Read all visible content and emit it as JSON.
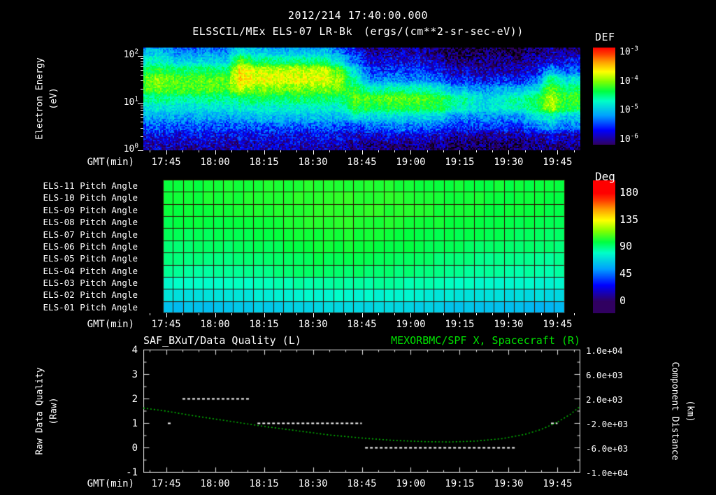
{
  "header": {
    "datetime": "2012/214 17:40:00.000"
  },
  "time_axis": {
    "title": "GMT(min)",
    "ticks": [
      "17:45",
      "18:00",
      "18:15",
      "18:30",
      "18:45",
      "19:00",
      "19:15",
      "19:30",
      "19:45"
    ],
    "start_min": 1058,
    "end_min": 1192
  },
  "colors": {
    "background": "#000000",
    "text": "#ffffff",
    "title_right_green": "#00e300",
    "distance_curve_green": "#00b800",
    "pitch_grid": "#2e0e00",
    "axis_box": "#e8e8e8"
  },
  "colormap": {
    "positions": [
      0,
      0.15,
      0.3,
      0.45,
      0.55,
      0.65,
      0.75,
      0.85,
      0.93,
      1
    ],
    "colors": [
      "#300060",
      "#0000ff",
      "#00a0ff",
      "#00ffc8",
      "#00ff40",
      "#80ff00",
      "#ffff00",
      "#ffa000",
      "#ff4000",
      "#ff0000"
    ]
  },
  "chart_data": [
    {
      "type": "heatmap",
      "title": "ELSSCIL/MEx ELS-07 LR-Bk",
      "units_display": "(ergs/(cm**2-sr-sec-eV))",
      "xlabel": "GMT(min)",
      "ylabel_line1": "Electron Energy",
      "ylabel_line2": "(eV)",
      "log_label_base": "10",
      "y_scale": "log",
      "y_tick_exponents": [
        2,
        1,
        0
      ],
      "log_energy_min": 0,
      "log_energy_max": 2.18,
      "colorbar": {
        "title": "DEF",
        "tick_exponents": [
          -3,
          -4,
          -5,
          -6
        ],
        "log_min": -6.15,
        "log_max": -2.8
      },
      "grid": {
        "t0_min": 1058,
        "dt_min": 5,
        "log_e_row0": 0.1,
        "dlog_e": 0.2,
        "rows_bottom_to_top": [
          [
            -5.9,
            -5.9,
            -5.9,
            -5.9,
            -5.9,
            -5.9,
            -5.9,
            -5.9,
            -5.9,
            -5.9,
            -5.9,
            -5.9,
            -5.9,
            -6.0,
            -6.1,
            -6.1,
            -6.1,
            -6.1,
            -6.1,
            -6.2,
            -6.2,
            -6.2,
            -6.2,
            -6.2,
            -6.1,
            -6.1,
            -6.1
          ],
          [
            -5.7,
            -5.7,
            -5.7,
            -5.7,
            -5.7,
            -5.7,
            -5.7,
            -5.7,
            -5.7,
            -5.7,
            -5.7,
            -5.7,
            -5.7,
            -5.8,
            -5.8,
            -5.8,
            -5.8,
            -5.8,
            -5.8,
            -6.0,
            -6.0,
            -6.0,
            -6.0,
            -6.0,
            -5.9,
            -5.8,
            -5.9
          ],
          [
            -5.4,
            -5.4,
            -5.4,
            -5.4,
            -5.4,
            -5.4,
            -5.4,
            -5.4,
            -5.4,
            -5.4,
            -5.4,
            -5.4,
            -5.4,
            -5.5,
            -5.3,
            -5.3,
            -5.3,
            -5.3,
            -5.3,
            -5.5,
            -5.5,
            -5.5,
            -5.5,
            -5.5,
            -5.3,
            -5.1,
            -5.3
          ],
          [
            -5.1,
            -5.1,
            -5.1,
            -5.1,
            -5.1,
            -5.1,
            -5.0,
            -5.0,
            -5.0,
            -5.0,
            -5.0,
            -5.0,
            -5.0,
            -4.8,
            -4.9,
            -4.9,
            -4.9,
            -4.9,
            -4.9,
            -5.2,
            -5.2,
            -5.2,
            -5.2,
            -5.2,
            -4.9,
            -4.7,
            -5.0
          ],
          [
            -4.8,
            -4.8,
            -4.8,
            -4.8,
            -4.8,
            -4.8,
            -4.7,
            -4.7,
            -4.7,
            -4.7,
            -4.7,
            -4.7,
            -4.7,
            -4.3,
            -4.3,
            -4.3,
            -4.3,
            -4.3,
            -4.3,
            -4.6,
            -4.7,
            -4.9,
            -4.7,
            -4.6,
            -4.4,
            -3.9,
            -4.3
          ],
          [
            -4.5,
            -4.5,
            -4.5,
            -4.5,
            -4.5,
            -4.5,
            -4.4,
            -4.4,
            -4.4,
            -4.4,
            -4.4,
            -4.4,
            -4.4,
            -4.1,
            -4.1,
            -4.1,
            -4.1,
            -4.1,
            -4.2,
            -4.5,
            -4.6,
            -4.9,
            -4.7,
            -4.5,
            -4.4,
            -3.9,
            -4.2
          ],
          [
            -4.1,
            -4.1,
            -4.1,
            -4.1,
            -4.1,
            -4.1,
            -3.8,
            -4.0,
            -4.0,
            -4.0,
            -4.0,
            -4.0,
            -4.0,
            -4.3,
            -4.6,
            -4.6,
            -4.6,
            -4.6,
            -4.7,
            -5.0,
            -5.1,
            -5.2,
            -5.1,
            -5.0,
            -4.9,
            -4.1,
            -4.4
          ],
          [
            -4.1,
            -4.0,
            -4.1,
            -4.1,
            -4.1,
            -4.1,
            -3.5,
            -3.7,
            -3.7,
            -3.7,
            -3.7,
            -3.7,
            -3.9,
            -4.6,
            -5.2,
            -5.2,
            -5.2,
            -5.2,
            -5.3,
            -5.6,
            -5.6,
            -5.7,
            -5.6,
            -5.6,
            -5.4,
            -4.5,
            -4.8
          ],
          [
            -4.4,
            -4.3,
            -4.4,
            -4.4,
            -4.4,
            -4.4,
            -3.6,
            -3.8,
            -3.8,
            -3.8,
            -3.8,
            -3.8,
            -4.1,
            -4.9,
            -5.5,
            -5.5,
            -5.5,
            -5.5,
            -5.6,
            -5.9,
            -5.9,
            -6.0,
            -5.9,
            -5.9,
            -5.7,
            -5.2,
            -5.4
          ],
          [
            -4.7,
            -4.7,
            -4.9,
            -4.9,
            -4.9,
            -4.9,
            -4.1,
            -4.5,
            -4.5,
            -4.5,
            -4.5,
            -4.5,
            -4.8,
            -5.3,
            -5.8,
            -5.8,
            -5.8,
            -5.8,
            -5.9,
            -6.1,
            -6.1,
            -6.1,
            -6.1,
            -6.1,
            -6.0,
            -5.8,
            -5.7
          ],
          [
            -5.0,
            -5.0,
            -5.2,
            -5.2,
            -5.2,
            -5.2,
            -4.7,
            -5.0,
            -5.0,
            -5.0,
            -5.0,
            -5.0,
            -5.2,
            -5.6,
            -6.0,
            -6.0,
            -6.0,
            -6.0,
            -6.1,
            -6.3,
            -6.3,
            -6.3,
            -6.3,
            -6.3,
            -6.2,
            -6.0,
            -6.1
          ],
          [
            -5.6,
            -5.6,
            -5.6,
            -5.6,
            -5.6,
            -5.6,
            -5.4,
            -5.4,
            -5.4,
            -5.4,
            -5.4,
            -5.4,
            -5.6,
            -5.9,
            -6.2,
            -6.2,
            -6.2,
            -6.2,
            -6.2,
            -6.4,
            -6.4,
            -6.4,
            -6.4,
            -6.4,
            -6.3,
            -6.2,
            -6.3
          ]
        ]
      }
    },
    {
      "type": "heatmap",
      "xlabel": "GMT(min)",
      "row_labels_top_to_bottom": [
        "ELS-11 Pitch Angle",
        "ELS-10 Pitch Angle",
        "ELS-09 Pitch Angle",
        "ELS-08 Pitch Angle",
        "ELS-07 Pitch Angle",
        "ELS-06 Pitch Angle",
        "ELS-05 Pitch Angle",
        "ELS-04 Pitch Angle",
        "ELS-03 Pitch Angle",
        "ELS-02 Pitch Angle",
        "ELS-01 Pitch Angle"
      ],
      "colorbar": {
        "title": "Deg",
        "ticks": [
          180,
          135,
          90,
          45,
          0
        ],
        "deg_min": 0,
        "deg_max": 180
      },
      "data_start_min": 1064,
      "data_end_min": 1187,
      "n_cols": 40,
      "values_deg_top_to_bottom": [
        [
          100,
          101,
          102,
          103,
          104,
          103,
          101,
          100,
          100,
          99
        ],
        [
          101,
          102,
          103,
          104,
          105,
          104,
          102,
          101,
          100,
          100
        ],
        [
          100,
          101,
          102,
          104,
          105,
          104,
          102,
          101,
          100,
          99
        ],
        [
          98,
          99,
          101,
          103,
          104,
          103,
          101,
          99,
          98,
          97
        ],
        [
          96,
          97,
          99,
          101,
          102,
          101,
          99,
          97,
          96,
          95
        ],
        [
          93,
          94,
          96,
          99,
          100,
          99,
          97,
          95,
          93,
          92
        ],
        [
          90,
          91,
          93,
          96,
          97,
          96,
          94,
          91,
          89,
          88
        ],
        [
          87,
          88,
          90,
          93,
          94,
          93,
          91,
          88,
          86,
          85
        ],
        [
          80,
          81,
          83,
          86,
          87,
          86,
          84,
          81,
          79,
          78
        ],
        [
          72,
          73,
          75,
          78,
          79,
          78,
          76,
          73,
          71,
          70
        ],
        [
          63,
          64,
          66,
          69,
          70,
          69,
          67,
          64,
          62,
          61
        ]
      ]
    },
    {
      "type": "line",
      "title_left": "SAF_BXuT/Data Quality (L)",
      "title_right": "MEXORBMC/SPF X, Spacecraft (R)",
      "xlabel": "GMT(min)",
      "ylabel_left_line1": "Raw Data Quality",
      "ylabel_left_line2": "(Raw)",
      "ylabel_right_line1": "Component Distance",
      "ylabel_right_line2": "(km)",
      "ylim_left": [
        -1,
        4
      ],
      "ylim_right": [
        -10000,
        10000
      ],
      "y_ticks_left": [
        "4",
        "3",
        "2",
        "1",
        "0",
        "-1"
      ],
      "y_ticks_right": [
        "1.0e+04",
        "6.0e+03",
        "2.0e+03",
        "-2.0e+03",
        "-6.0e+03",
        "-1.0e+04"
      ],
      "quality_segments": [
        {
          "start_min": 1065.5,
          "end_min": 1067,
          "value": 1
        },
        {
          "start_min": 1070,
          "end_min": 1091,
          "value": 2
        },
        {
          "start_min": 1093,
          "end_min": 1125,
          "value": 1
        },
        {
          "start_min": 1126,
          "end_min": 1172,
          "value": 0
        },
        {
          "start_min": 1183,
          "end_min": 1185,
          "value": 1
        }
      ],
      "distance_series_km": {
        "t_min": [
          1058,
          1065,
          1075,
          1085,
          1095,
          1105,
          1115,
          1125,
          1135,
          1145,
          1152,
          1160,
          1168,
          1175,
          1180,
          1185,
          1189,
          1192
        ],
        "km": [
          500,
          0,
          -900,
          -1700,
          -2500,
          -3200,
          -3900,
          -4400,
          -4800,
          -5000,
          -5050,
          -4900,
          -4500,
          -3800,
          -3000,
          -1800,
          -500,
          800
        ]
      }
    }
  ]
}
